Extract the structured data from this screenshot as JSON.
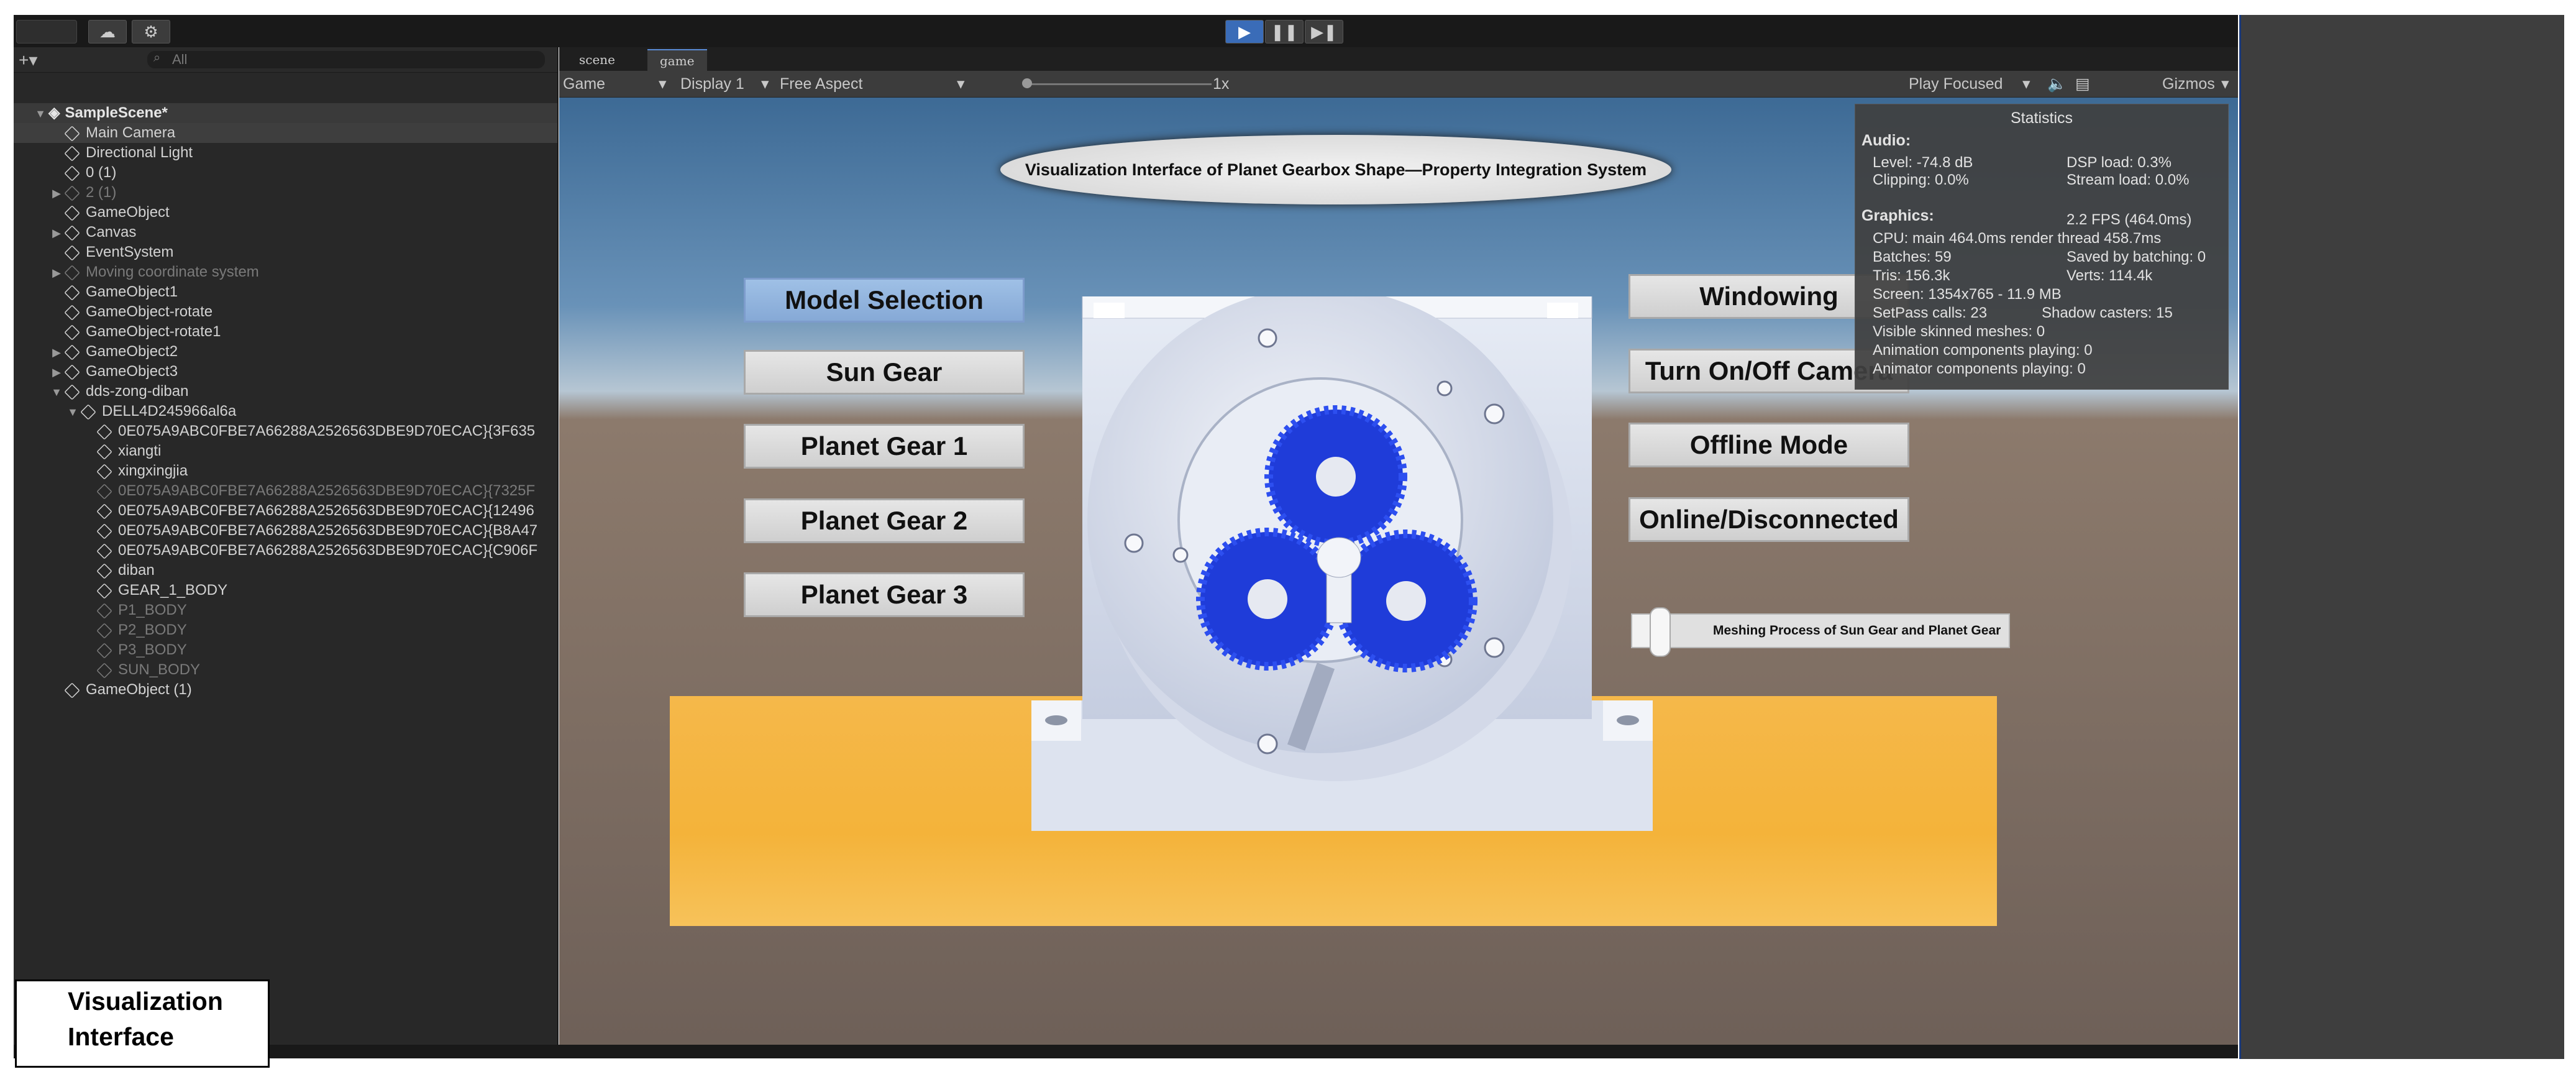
{
  "toolbar": {
    "play_icon": "play-icon",
    "pause_icon": "pause-icon",
    "step_icon": "step-icon"
  },
  "hierarchy": {
    "search_placeholder": "All",
    "scene_name": "SampleScene*",
    "items": [
      {
        "label": "Main Camera",
        "depth": 1,
        "arrow": "",
        "dim": false,
        "selected": true
      },
      {
        "label": "Directional Light",
        "depth": 1,
        "arrow": "",
        "dim": false
      },
      {
        "label": "0 (1)",
        "depth": 1,
        "arrow": "",
        "dim": false
      },
      {
        "label": "2 (1)",
        "depth": 1,
        "arrow": "▶",
        "dim": true
      },
      {
        "label": "GameObject",
        "depth": 1,
        "arrow": "",
        "dim": false
      },
      {
        "label": "Canvas",
        "depth": 1,
        "arrow": "▶",
        "dim": false
      },
      {
        "label": "EventSystem",
        "depth": 1,
        "arrow": "",
        "dim": false
      },
      {
        "label": "Moving coordinate system",
        "depth": 1,
        "arrow": "▶",
        "dim": true
      },
      {
        "label": "GameObject1",
        "depth": 1,
        "arrow": "",
        "dim": false
      },
      {
        "label": "GameObject-rotate",
        "depth": 1,
        "arrow": "",
        "dim": false
      },
      {
        "label": "GameObject-rotate1",
        "depth": 1,
        "arrow": "",
        "dim": false
      },
      {
        "label": "GameObject2",
        "depth": 1,
        "arrow": "▶",
        "dim": false
      },
      {
        "label": "GameObject3",
        "depth": 1,
        "arrow": "▶",
        "dim": false
      },
      {
        "label": "dds-zong-diban",
        "depth": 1,
        "arrow": "▼",
        "dim": false
      },
      {
        "label": "DELL4D245966al6a",
        "depth": 2,
        "arrow": "▼",
        "dim": false
      },
      {
        "label": "0E075A9ABC0FBE7A66288A2526563DBE9D70ECAC}{3F635",
        "depth": 3,
        "arrow": "",
        "dim": false
      },
      {
        "label": "xiangti",
        "depth": 3,
        "arrow": "",
        "dim": false
      },
      {
        "label": "xingxingjia",
        "depth": 3,
        "arrow": "",
        "dim": false
      },
      {
        "label": "0E075A9ABC0FBE7A66288A2526563DBE9D70ECAC}{7325F",
        "depth": 3,
        "arrow": "",
        "dim": true
      },
      {
        "label": "0E075A9ABC0FBE7A66288A2526563DBE9D70ECAC}{12496",
        "depth": 3,
        "arrow": "",
        "dim": false
      },
      {
        "label": "0E075A9ABC0FBE7A66288A2526563DBE9D70ECAC}{B8A47",
        "depth": 3,
        "arrow": "",
        "dim": false
      },
      {
        "label": "0E075A9ABC0FBE7A66288A2526563DBE9D70ECAC}{C906F",
        "depth": 3,
        "arrow": "",
        "dim": false
      },
      {
        "label": "diban",
        "depth": 3,
        "arrow": "",
        "dim": false
      },
      {
        "label": "GEAR_1_BODY",
        "depth": 3,
        "arrow": "",
        "dim": false
      },
      {
        "label": "P1_BODY",
        "depth": 3,
        "arrow": "",
        "dim": true
      },
      {
        "label": "P2_BODY",
        "depth": 3,
        "arrow": "",
        "dim": true
      },
      {
        "label": "P3_BODY",
        "depth": 3,
        "arrow": "",
        "dim": true
      },
      {
        "label": "SUN_BODY",
        "depth": 3,
        "arrow": "",
        "dim": true
      },
      {
        "label": "GameObject (1)",
        "depth": 1,
        "arrow": "",
        "dim": false
      }
    ]
  },
  "tabs": [
    {
      "label": "scene",
      "active": false
    },
    {
      "label": "game",
      "active": true
    }
  ],
  "gamebar": {
    "mode": "Game",
    "display": "Display 1",
    "aspect": "Free Aspect",
    "scale_label": "1x",
    "play_focused": "Play Focused",
    "gizmos": "Gizmos"
  },
  "game": {
    "title": "Visualization Interface of Planet Gearbox Shape—Property Integration System",
    "left_buttons": [
      "Model Selection",
      "Sun Gear",
      "Planet Gear 1",
      "Planet Gear 2",
      "Planet Gear 3"
    ],
    "right_buttons": [
      "Windowing",
      "Turn On/Off Camera",
      "Offline Mode",
      "Online/Disconnected"
    ],
    "slider_label": "Meshing Process of Sun Gear and Planet Gear",
    "slider_value": 0.06
  },
  "stats": {
    "title": "Statistics",
    "audio_header": "Audio:",
    "level": "Level: -74.8 dB",
    "dsp": "DSP load: 0.3%",
    "clipping": "Clipping: 0.0%",
    "stream": "Stream load: 0.0%",
    "graphics_header": "Graphics:",
    "fps": "2.2 FPS (464.0ms)",
    "cpu": "CPU: main 464.0ms  render thread 458.7ms",
    "batches": "Batches: 59",
    "saved": "Saved by batching: 0",
    "tris": "Tris: 156.3k",
    "verts": "Verts: 114.4k",
    "screen": "Screen: 1354x765 - 11.9 MB",
    "setpass": "SetPass calls: 23",
    "shadow": "Shadow casters: 15",
    "skinned": "Visible skinned meshes: 0",
    "anim": "Animation components playing: 0",
    "animator": "Animator components playing: 0"
  },
  "caption": "Visualization Interface",
  "colors": {
    "gear_blue": "#1f3cd9",
    "floor": "#f4b33a",
    "selected_button": "#8fb3e0"
  }
}
